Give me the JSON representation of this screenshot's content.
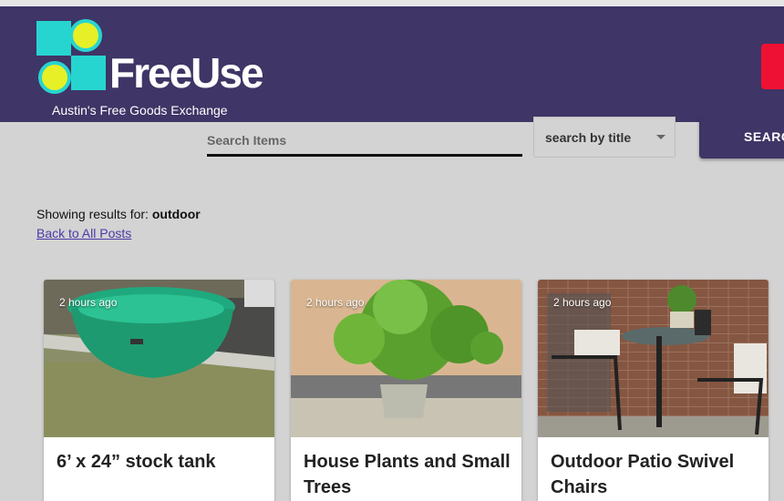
{
  "header": {
    "logo_text": "FreeUse",
    "tagline": "Austin's Free Goods Exchange",
    "brand_color": "#3f3566"
  },
  "search": {
    "placeholder": "Search Items",
    "select_value": "search by title",
    "button_label": "SEARCH"
  },
  "results": {
    "prefix": "Showing results for: ",
    "query": "outdoor",
    "back_link": "Back to All Posts"
  },
  "posts": [
    {
      "time": "2 hours ago",
      "title": "6’ x 24” stock tank",
      "image": "green-stock-tank-photo"
    },
    {
      "time": "2 hours ago",
      "title": "House Plants and Small Trees",
      "image": "potted-tree-photo"
    },
    {
      "time": "2 hours ago",
      "title": "Outdoor Patio Swivel Chairs",
      "image": "patio-chairs-photo"
    }
  ]
}
